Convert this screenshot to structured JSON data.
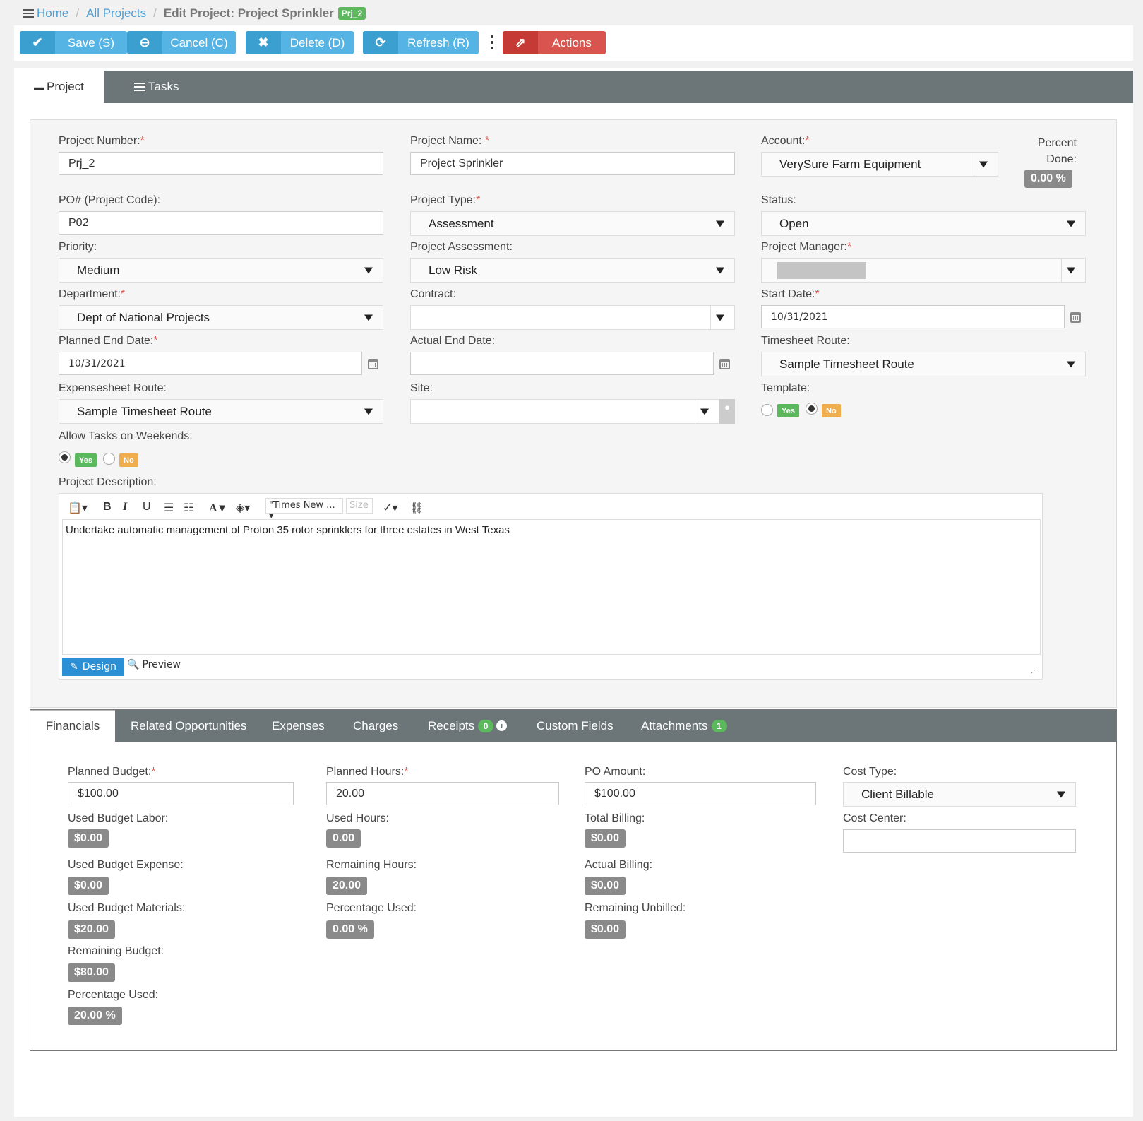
{
  "breadcrumb": {
    "home": "Home",
    "all_projects": "All Projects",
    "current": "Edit Project: Project Sprinkler",
    "badge": "Prj_2"
  },
  "toolbar": {
    "save": "Save (S)",
    "cancel": "Cancel (C)",
    "delete": "Delete (D)",
    "refresh": "Refresh (R)",
    "actions": "Actions"
  },
  "tabs": {
    "project": "Project",
    "tasks": "Tasks"
  },
  "form": {
    "project_number_label": "Project Number:",
    "project_number": "Prj_2",
    "project_name_label": "Project Name:",
    "project_name": "Project Sprinkler",
    "account_label": "Account:",
    "account": "VerySure Farm Equipment",
    "percent_done_label1": "Percent",
    "percent_done_label2": "Done:",
    "percent_done": "0.00 %",
    "po_label": "PO# (Project Code):",
    "po": "P02",
    "project_type_label": "Project Type:",
    "project_type": "Assessment",
    "status_label": "Status:",
    "status": "Open",
    "priority_label": "Priority:",
    "priority": "Medium",
    "assessment_label": "Project Assessment:",
    "assessment": "Low Risk",
    "manager_label": "Project Manager:",
    "department_label": "Department:",
    "department": "Dept of National Projects",
    "contract_label": "Contract:",
    "contract": "",
    "start_date_label": "Start Date:",
    "start_date": "10/31/2021",
    "planned_end_label": "Planned End Date:",
    "planned_end": "10/31/2021",
    "actual_end_label": "Actual End Date:",
    "actual_end": "",
    "timesheet_route_label": "Timesheet Route:",
    "timesheet_route": "Sample Timesheet Route",
    "expensesheet_route_label": "Expensesheet Route:",
    "expensesheet_route": "Sample Timesheet Route",
    "site_label": "Site:",
    "site": "",
    "template_label": "Template:",
    "yes": "Yes",
    "no": "No",
    "weekends_label": "Allow Tasks on Weekends:",
    "description_label": "Project Description:"
  },
  "editor": {
    "font": "\"Times New ...",
    "size": "Size",
    "content": "Undertake automatic management of Proton 35 rotor sprinklers for three estates in West Texas",
    "design": "Design",
    "preview": "Preview"
  },
  "bottom_tabs": {
    "financials": "Financials",
    "related": "Related Opportunities",
    "expenses": "Expenses",
    "charges": "Charges",
    "receipts": "Receipts",
    "receipts_count": "0",
    "custom": "Custom Fields",
    "attachments": "Attachments",
    "attachments_count": "1"
  },
  "financials": {
    "planned_budget_label": "Planned Budget:",
    "planned_budget": "$100.00",
    "used_labor_label": "Used Budget Labor:",
    "used_labor": "$0.00",
    "used_expense_label": "Used Budget Expense:",
    "used_expense": "$0.00",
    "used_materials_label": "Used Budget Materials:",
    "used_materials": "$20.00",
    "remaining_budget_label": "Remaining Budget:",
    "remaining_budget": "$80.00",
    "pct_used_label": "Percentage Used:",
    "pct_used": "20.00 %",
    "planned_hours_label": "Planned Hours:",
    "planned_hours": "20.00",
    "used_hours_label": "Used Hours:",
    "used_hours": "0.00",
    "remaining_hours_label": "Remaining Hours:",
    "remaining_hours": "20.00",
    "hours_pct_label": "Percentage Used:",
    "hours_pct": "0.00 %",
    "po_amount_label": "PO Amount:",
    "po_amount": "$100.00",
    "total_billing_label": "Total Billing:",
    "total_billing": "$0.00",
    "actual_billing_label": "Actual Billing:",
    "actual_billing": "$0.00",
    "remaining_unbilled_label": "Remaining Unbilled:",
    "remaining_unbilled": "$0.00",
    "cost_type_label": "Cost Type:",
    "cost_type": "Client Billable",
    "cost_center_label": "Cost Center:",
    "cost_center": ""
  }
}
